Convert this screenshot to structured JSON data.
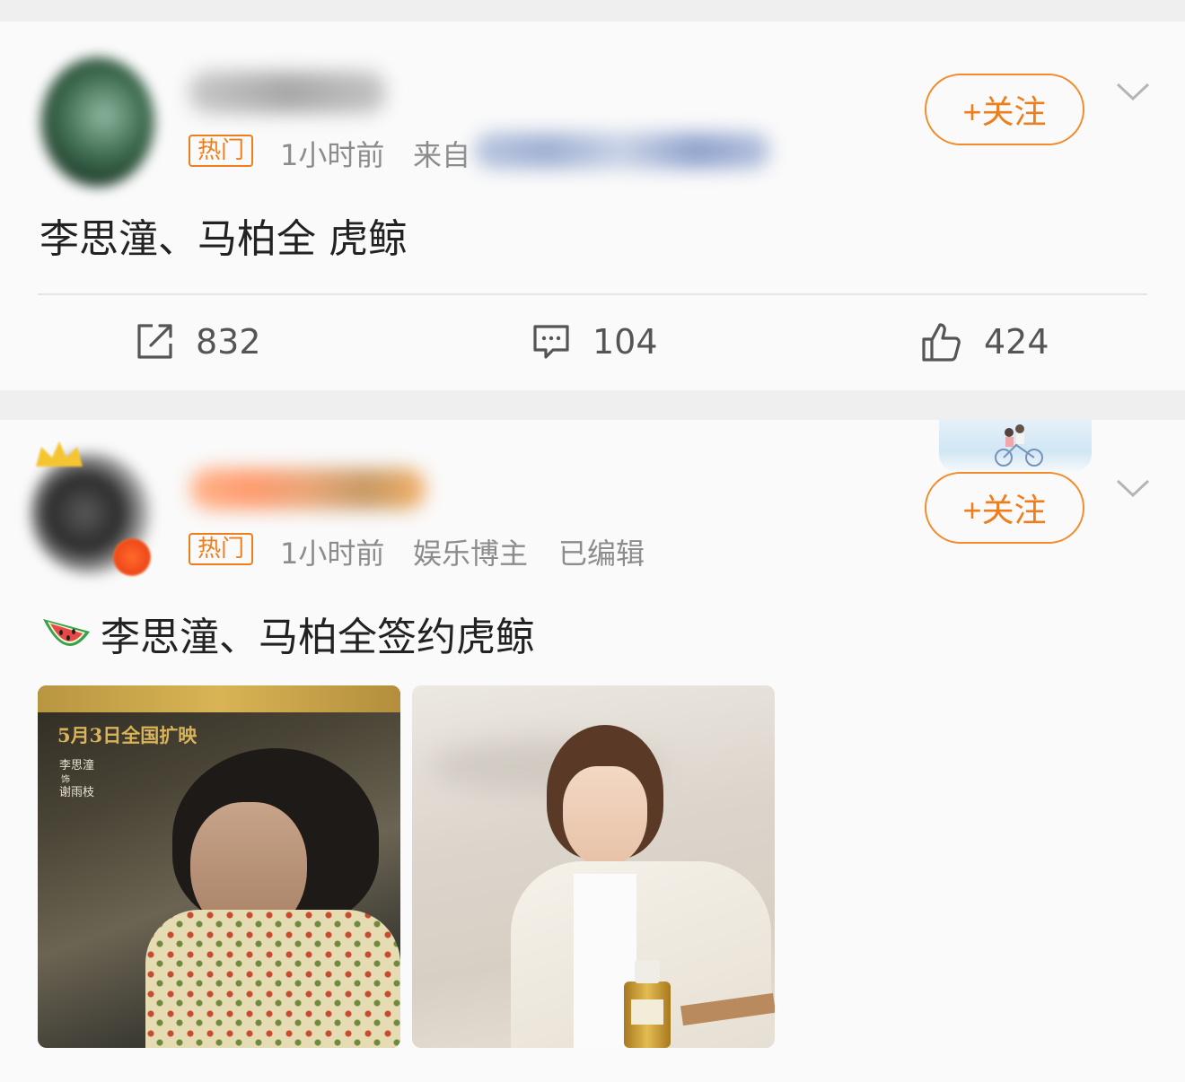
{
  "post1": {
    "badge": "热门",
    "time": "1小时前",
    "source_prefix": "来自",
    "follow_label": "+关注",
    "text": "李思潼、马柏全 虎鲸",
    "actions": {
      "repost": {
        "icon": "share-icon",
        "count": "832"
      },
      "comment": {
        "icon": "comment-icon",
        "count": "104"
      },
      "like": {
        "icon": "thumbs-up-icon",
        "count": "424"
      }
    }
  },
  "post2": {
    "badge": "热门",
    "time": "1小时前",
    "role": "娱乐博主",
    "edited": "已编辑",
    "follow_label": "+关注",
    "emoji": "🍉",
    "text": "李思潼、马柏全签约虎鲸",
    "images": [
      {
        "caption_title": "5月3日全国扩映",
        "caption_lines": [
          "李思潼",
          "饰",
          "谢雨枝"
        ]
      },
      {
        "label": ""
      }
    ]
  },
  "colors": {
    "accent": "#ee7d1c",
    "meta": "#8c8c8c",
    "card": "#fafafa",
    "page": "#efefef"
  }
}
